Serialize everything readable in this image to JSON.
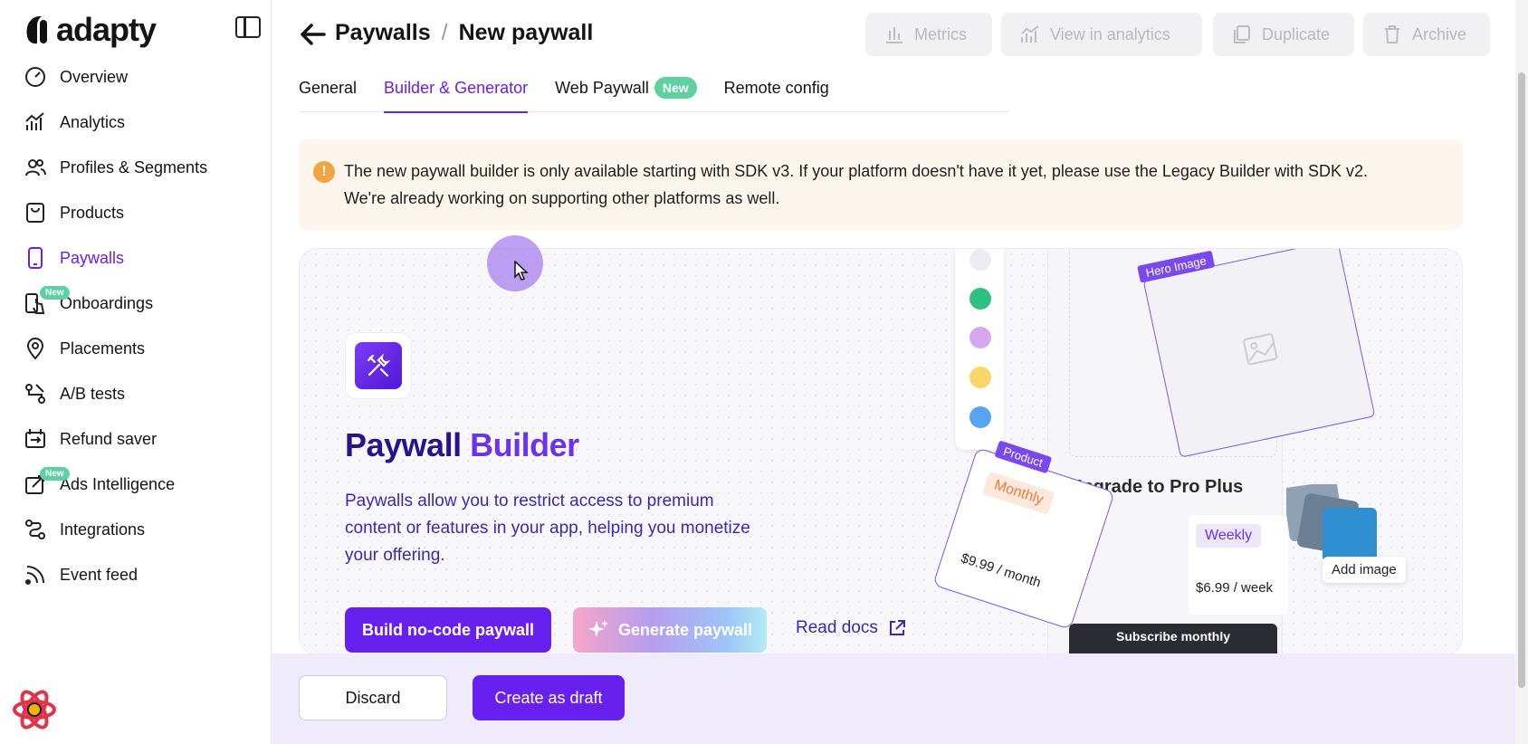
{
  "app": {
    "brand": "adapty"
  },
  "sidebar": {
    "items": [
      {
        "label": "Overview",
        "icon": "gauge-icon",
        "active": false
      },
      {
        "label": "Analytics",
        "icon": "chart-icon",
        "active": false
      },
      {
        "label": "Profiles & Segments",
        "icon": "users-icon",
        "active": false
      },
      {
        "label": "Products",
        "icon": "bag-icon",
        "active": false
      },
      {
        "label": "Paywalls",
        "icon": "phone-icon",
        "active": true
      },
      {
        "label": "Onboardings",
        "icon": "tap-icon",
        "active": false,
        "badge": "New"
      },
      {
        "label": "Placements",
        "icon": "pin-icon",
        "active": false
      },
      {
        "label": "A/B tests",
        "icon": "ab-icon",
        "active": false
      },
      {
        "label": "Refund saver",
        "icon": "refund-icon",
        "active": false
      },
      {
        "label": "Ads Intelligence",
        "icon": "ads-icon",
        "active": false,
        "badge": "New"
      },
      {
        "label": "Integrations",
        "icon": "integrations-icon",
        "active": false
      },
      {
        "label": "Event feed",
        "icon": "rss-icon",
        "active": false
      }
    ]
  },
  "header": {
    "breadcrumb_parent": "Paywalls",
    "breadcrumb_sep": "/",
    "breadcrumb_current": "New paywall",
    "buttons": {
      "metrics": "Metrics",
      "analytics": "View in analytics",
      "duplicate": "Duplicate",
      "archive": "Archive"
    }
  },
  "tabs": [
    {
      "label": "General",
      "active": false
    },
    {
      "label": "Builder & Generator",
      "active": true
    },
    {
      "label": "Web Paywall",
      "active": false,
      "badge": "New"
    },
    {
      "label": "Remote config",
      "active": false
    }
  ],
  "alert": {
    "line1": "The new paywall builder is only available starting with SDK v3. If your platform doesn't have it yet, please use the Legacy Builder with SDK v2.",
    "line2": "We're already working on supporting other platforms as well."
  },
  "builder": {
    "title_part1": "Paywall",
    "title_part2": "Builder",
    "description": "Paywalls allow you to restrict access to premium content or features in your app, helping you monetize your offering.",
    "build_button": "Build no-code paywall",
    "generate_button": "Generate paywall",
    "read_docs": "Read docs",
    "preview": {
      "hero_tag": "Hero Image",
      "upgrade_title": "Upgrade to Pro Plus",
      "product_tag": "Product",
      "monthly_label": "Monthly",
      "monthly_price": "$9.99 / month",
      "weekly_label": "Weekly",
      "weekly_price": "$6.99 / week",
      "subscribe_label": "Subscribe monthly",
      "add_image": "Add image"
    }
  },
  "footer": {
    "discard": "Discard",
    "create_draft": "Create as draft"
  },
  "colors": {
    "accent": "#6720ee",
    "new_badge": "#5ed0a2",
    "alert_bg": "#fdf6ec",
    "alert_icon": "#f0a540"
  }
}
